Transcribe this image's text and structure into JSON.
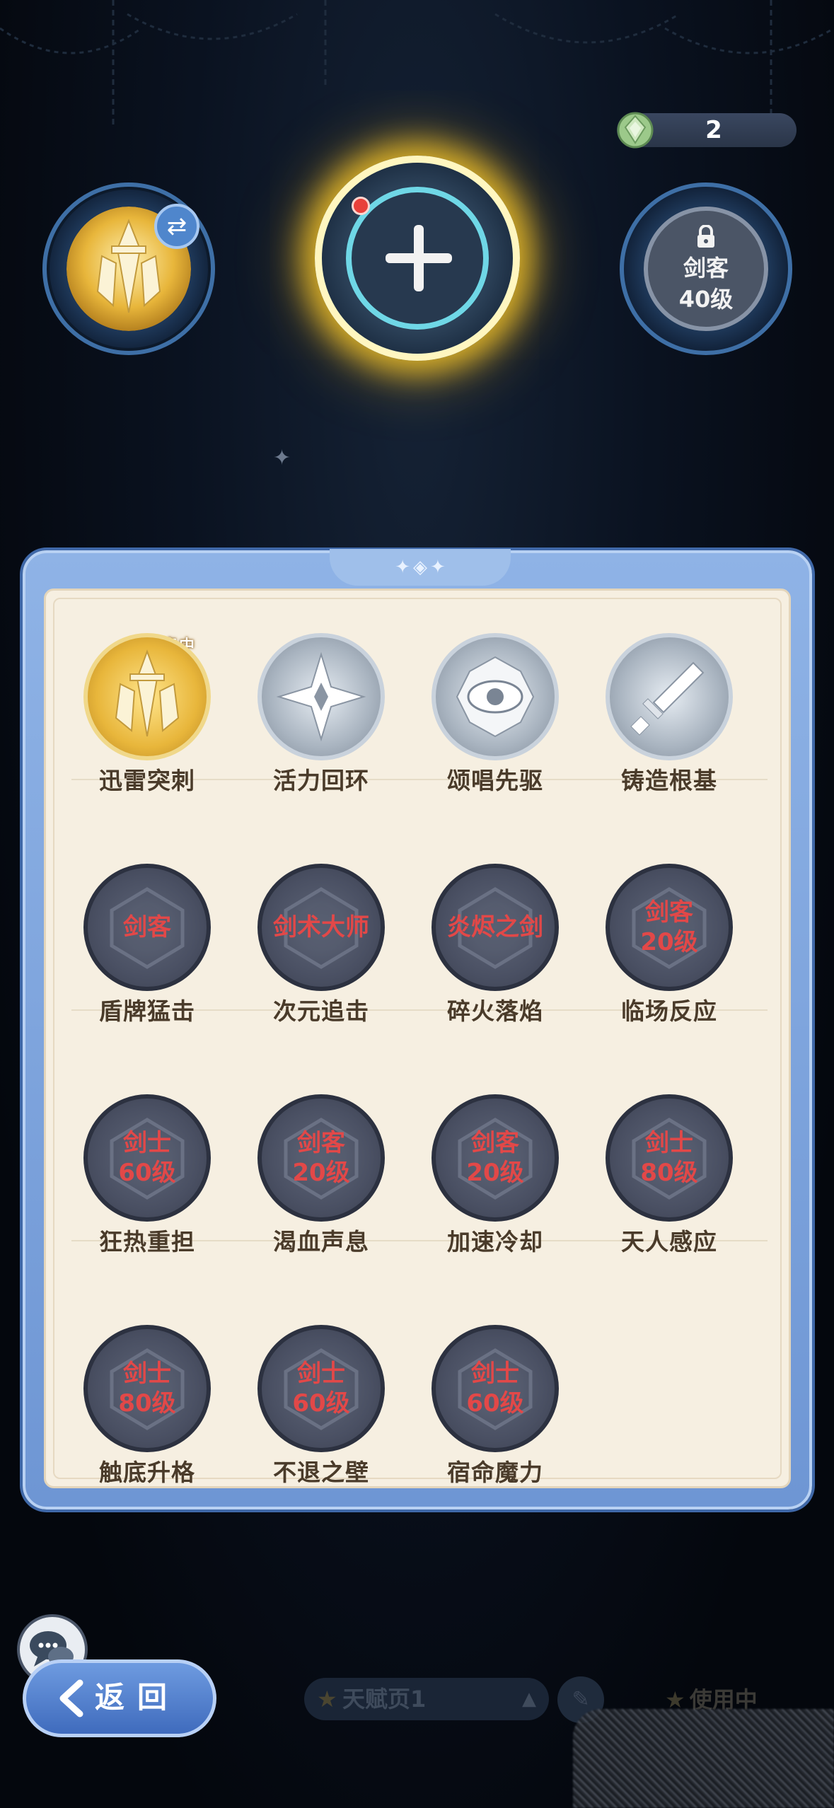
{
  "resource": {
    "count": "2",
    "icon": "green-gem-icon"
  },
  "slots": {
    "left": {
      "icon": "crystal-sword-medal-gold",
      "swap_icon": "⇄"
    },
    "center": {
      "icon": "plus-icon"
    },
    "right": {
      "line1": "剑客",
      "line2": "40级",
      "icon": "lock-icon"
    }
  },
  "skills": [
    {
      "name": "迅雷突刺",
      "state": "equipped",
      "tag": "装备中"
    },
    {
      "name": "活力回环",
      "state": "unlocked"
    },
    {
      "name": "颂唱先驱",
      "state": "unlocked"
    },
    {
      "name": "铸造根基",
      "state": "unlocked"
    },
    {
      "name": "盾牌猛击",
      "state": "locked",
      "requirement": "剑客"
    },
    {
      "name": "次元追击",
      "state": "locked",
      "requirement": "剑术大师"
    },
    {
      "name": "碎火落焰",
      "state": "locked",
      "requirement": "炎烬之剑"
    },
    {
      "name": "临场反应",
      "state": "locked",
      "requirement": "剑客\n20级"
    },
    {
      "name": "狂热重担",
      "state": "locked",
      "requirement": "剑士\n60级"
    },
    {
      "name": "渴血声息",
      "state": "locked",
      "requirement": "剑客\n20级"
    },
    {
      "name": "加速冷却",
      "state": "locked",
      "requirement": "剑客\n20级"
    },
    {
      "name": "天人感应",
      "state": "locked",
      "requirement": "剑士\n80级"
    },
    {
      "name": "触底升格",
      "state": "locked",
      "requirement": "剑士\n80级"
    },
    {
      "name": "不退之壁",
      "state": "locked",
      "requirement": "剑士\n60级"
    },
    {
      "name": "宿命魔力",
      "state": "locked",
      "requirement": "剑士\n60级"
    }
  ],
  "bottom": {
    "back_label": "返回",
    "page_label": "天赋页1",
    "in_use_label": "使用中"
  },
  "colors": {
    "panel_blue": "#7fa6e0",
    "panel_cream": "#f6efe1",
    "locked_text": "#e24848",
    "glow_gold": "#ffcc28"
  }
}
